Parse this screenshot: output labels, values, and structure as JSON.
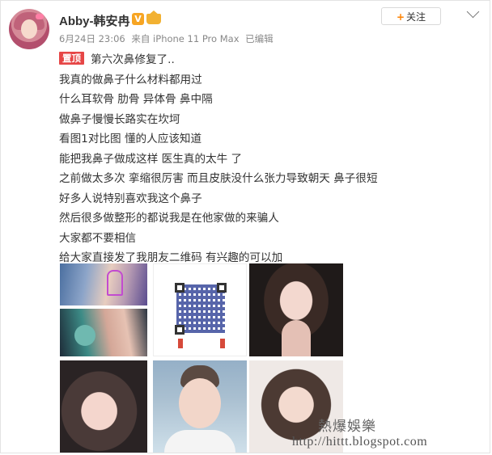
{
  "header": {
    "username": "Abby-韩安冉",
    "verified_badge": "V",
    "timestamp": "6月24日 23:06",
    "source": "来自 iPhone 11 Pro Max",
    "edited": "已编辑",
    "follow_plus": "+",
    "follow_label": "关注"
  },
  "post": {
    "pin_label": "置顶",
    "lines": [
      "第六次鼻修复了..",
      "我真的做鼻子什么材料都用过",
      "什么耳软骨 肋骨 异体骨 鼻中隔",
      "做鼻子慢慢长路实在坎坷",
      "看图1对比图 懂的人应该知道",
      "能把我鼻子做成这样 医生真的太牛 了",
      "之前做太多次 挛缩很厉害 而且皮肤没什么张力导致朝天 鼻子很短",
      "好多人说特别喜欢我这个鼻子",
      "然后很多做整形的都说我是在他家做的来骗人",
      "大家都不要相信",
      "给大家直接发了我朋友二维码 有兴趣的可以加"
    ]
  },
  "images": [
    {
      "name": "before-after-photo-top",
      "kind": "photo"
    },
    {
      "name": "before-after-photo-bottom",
      "kind": "photo"
    },
    {
      "name": "qr-code-image",
      "kind": "qr"
    },
    {
      "name": "selfie-car",
      "kind": "photo"
    },
    {
      "name": "selfie-closeup-1",
      "kind": "photo"
    },
    {
      "name": "selfie-hospital",
      "kind": "photo"
    },
    {
      "name": "selfie-closeup-2",
      "kind": "photo"
    }
  ],
  "watermark": {
    "title": "熱爆娛樂",
    "url": "http://hittt.blogspot.com"
  },
  "colors": {
    "pin_red": "#e64646",
    "follow_orange": "#ff8200",
    "verified_gold": "#f7a523"
  }
}
